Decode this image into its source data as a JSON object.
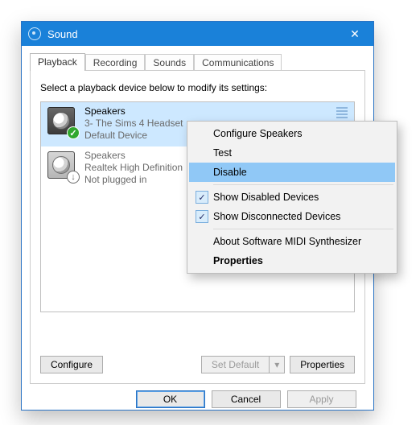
{
  "window": {
    "title": "Sound",
    "close_icon": "✕"
  },
  "tabs": [
    {
      "label": "Playback"
    },
    {
      "label": "Recording"
    },
    {
      "label": "Sounds"
    },
    {
      "label": "Communications"
    }
  ],
  "panel": {
    "instruction": "Select a playback device below to modify its settings:"
  },
  "devices": [
    {
      "title": "Speakers",
      "subtitle": "3- The Sims 4 Headset",
      "status": "Default Device",
      "badge": "check"
    },
    {
      "title": "Speakers",
      "subtitle": "Realtek High Definition ",
      "status": "Not plugged in",
      "badge": "down"
    }
  ],
  "buttons": {
    "configure": "Configure",
    "set_default": "Set Default",
    "set_default_caret": "▾",
    "properties": "Properties",
    "ok": "OK",
    "cancel": "Cancel",
    "apply": "Apply"
  },
  "context_menu": {
    "items": [
      {
        "label": "Configure Speakers"
      },
      {
        "label": "Test"
      },
      {
        "label": "Disable",
        "highlight": true
      },
      {
        "sep": true
      },
      {
        "label": "Show Disabled Devices",
        "checked": true
      },
      {
        "label": "Show Disconnected Devices",
        "checked": true
      },
      {
        "sep": true
      },
      {
        "label": "About Software MIDI Synthesizer"
      },
      {
        "label": "Properties",
        "bold": true
      }
    ]
  }
}
